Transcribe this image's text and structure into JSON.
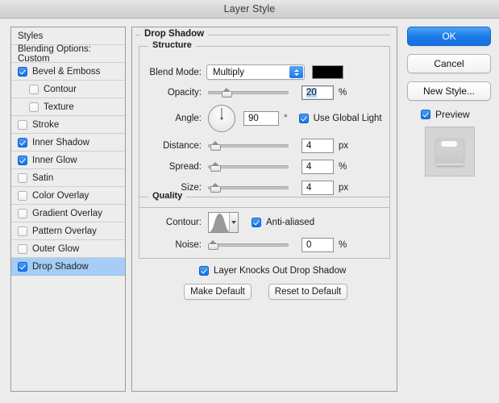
{
  "window": {
    "title": "Layer Style"
  },
  "styles_list": {
    "header": "Styles",
    "blending_options": "Blending Options: Custom",
    "items": [
      {
        "label": "Bevel & Emboss",
        "checked": true,
        "sub": false,
        "selected": false
      },
      {
        "label": "Contour",
        "checked": false,
        "sub": true,
        "selected": false
      },
      {
        "label": "Texture",
        "checked": false,
        "sub": true,
        "selected": false
      },
      {
        "label": "Stroke",
        "checked": false,
        "sub": false,
        "selected": false
      },
      {
        "label": "Inner Shadow",
        "checked": true,
        "sub": false,
        "selected": false
      },
      {
        "label": "Inner Glow",
        "checked": true,
        "sub": false,
        "selected": false
      },
      {
        "label": "Satin",
        "checked": false,
        "sub": false,
        "selected": false
      },
      {
        "label": "Color Overlay",
        "checked": false,
        "sub": false,
        "selected": false
      },
      {
        "label": "Gradient Overlay",
        "checked": false,
        "sub": false,
        "selected": false
      },
      {
        "label": "Pattern Overlay",
        "checked": false,
        "sub": false,
        "selected": false
      },
      {
        "label": "Outer Glow",
        "checked": false,
        "sub": false,
        "selected": false
      },
      {
        "label": "Drop Shadow",
        "checked": true,
        "sub": false,
        "selected": true
      }
    ]
  },
  "panel": {
    "section_title": "Drop Shadow",
    "structure": {
      "title": "Structure",
      "blend_mode": {
        "label": "Blend Mode:",
        "value": "Multiply",
        "color": "#000000"
      },
      "opacity": {
        "label": "Opacity:",
        "value": "20",
        "unit": "%",
        "slider_pct": 20
      },
      "angle": {
        "label": "Angle:",
        "value": "90",
        "unit": "°",
        "degrees": 90,
        "use_global_light": {
          "label": "Use Global Light",
          "checked": true
        }
      },
      "distance": {
        "label": "Distance:",
        "value": "4",
        "unit": "px",
        "slider_pct": 4
      },
      "spread": {
        "label": "Spread:",
        "value": "4",
        "unit": "%",
        "slider_pct": 4
      },
      "size": {
        "label": "Size:",
        "value": "4",
        "unit": "px",
        "slider_pct": 4
      }
    },
    "quality": {
      "title": "Quality",
      "contour": {
        "label": "Contour:"
      },
      "anti_aliased": {
        "label": "Anti-aliased",
        "checked": true
      },
      "noise": {
        "label": "Noise:",
        "value": "0",
        "unit": "%",
        "slider_pct": 0
      }
    },
    "knockout": {
      "label": "Layer Knocks Out Drop Shadow",
      "checked": true
    },
    "make_default": "Make Default",
    "reset_to_default": "Reset to Default"
  },
  "actions": {
    "ok": "OK",
    "cancel": "Cancel",
    "new_style": "New Style...",
    "preview": {
      "label": "Preview",
      "checked": true
    }
  },
  "colors": {
    "accent": "#1d7ae9",
    "selection": "#a6cdf5",
    "text_selection": "#b6d5f5"
  }
}
